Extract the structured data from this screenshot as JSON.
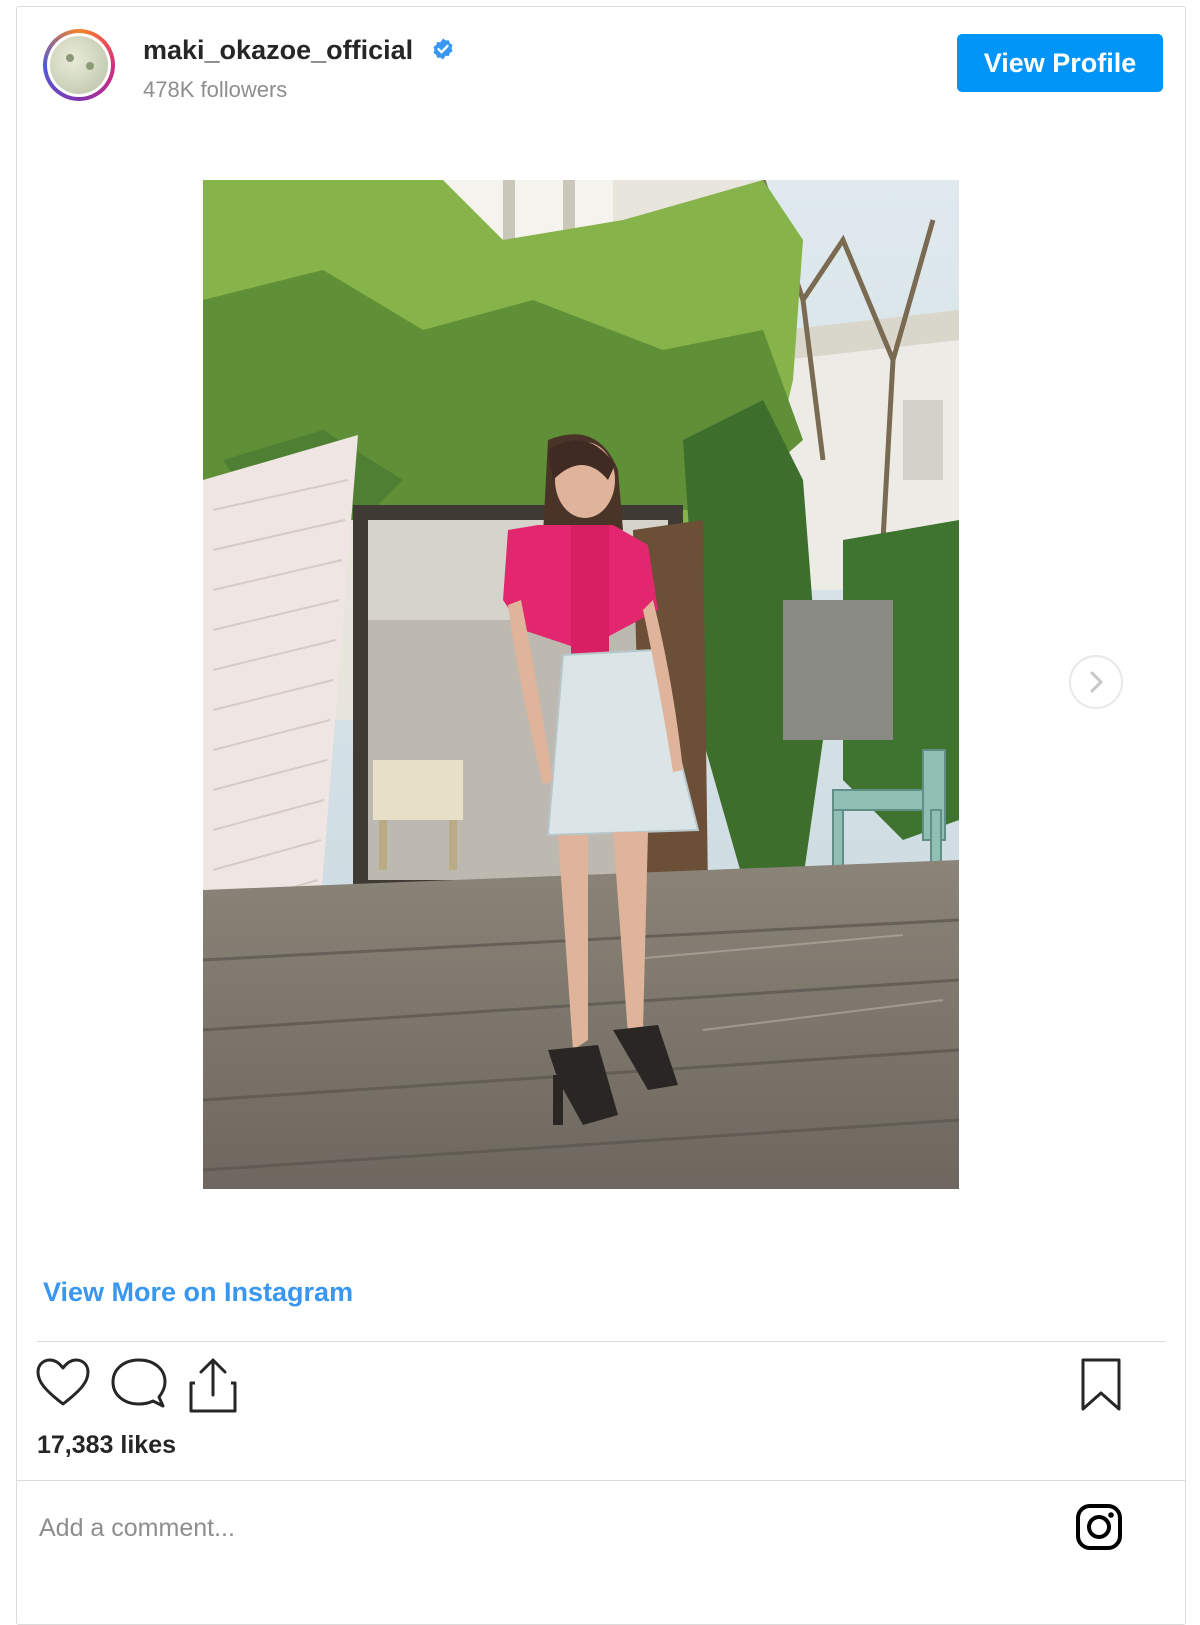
{
  "profile": {
    "username": "maki_okazoe_official",
    "followers": "478K followers",
    "view_profile_label": "View Profile"
  },
  "post": {
    "view_more_label": "View More on Instagram",
    "likes": "17,383 likes",
    "comment_placeholder": "Add a comment..."
  },
  "colors": {
    "accent": "#0095f6",
    "link": "#3897f0",
    "text": "#262626",
    "muted": "#8e8e8e",
    "border": "#dbdbdb"
  },
  "icons": {
    "verified": "verified-badge-icon",
    "like": "heart-icon",
    "comment": "comment-bubble-icon",
    "share": "share-icon",
    "save": "bookmark-icon",
    "next": "chevron-right-icon",
    "brand": "instagram-logo-icon"
  }
}
